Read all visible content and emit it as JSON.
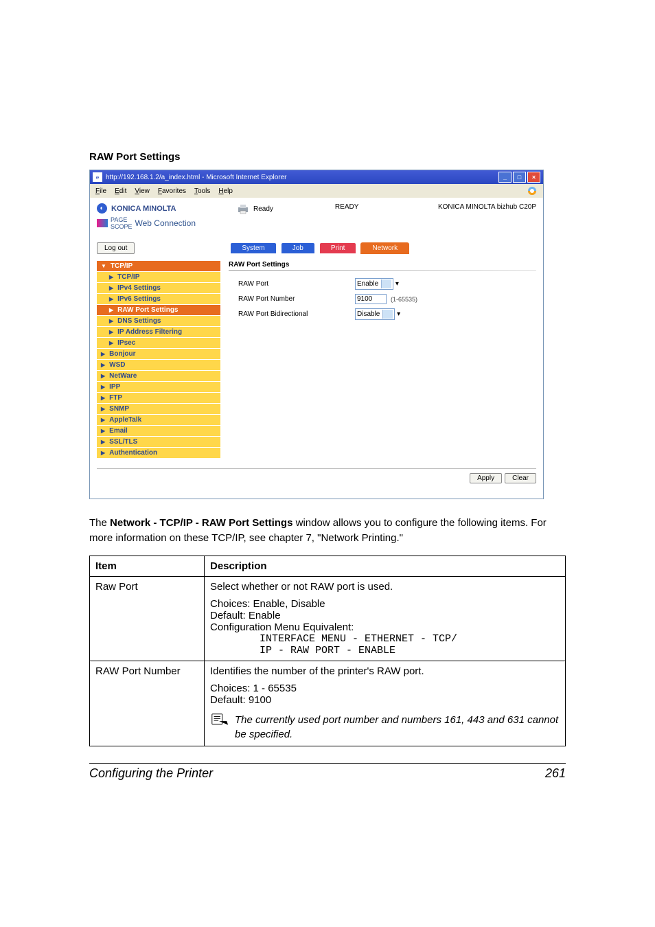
{
  "section_title": "RAW Port Settings",
  "browser": {
    "title": "http://192.168.1.2/a_index.html - Microsoft Internet Explorer",
    "menu": [
      "File",
      "Edit",
      "View",
      "Favorites",
      "Tools",
      "Help"
    ]
  },
  "header": {
    "brand": "KONICA MINOLTA",
    "pagescope": "Web Connection",
    "status_label": "Ready",
    "status_center": "READY",
    "model": "KONICA MINOLTA bizhub C20P"
  },
  "logout": "Log out",
  "tabs": [
    "System",
    "Job",
    "Print",
    "Network"
  ],
  "sidebar": {
    "head": "TCP/IP",
    "items": [
      {
        "label": "TCP/IP",
        "type": "sub"
      },
      {
        "label": "IPv4 Settings",
        "type": "sub"
      },
      {
        "label": "IPv6 Settings",
        "type": "sub"
      },
      {
        "label": "RAW Port Settings",
        "type": "sub",
        "selected": true
      },
      {
        "label": "DNS Settings",
        "type": "sub"
      },
      {
        "label": "IP Address Filtering",
        "type": "sub"
      },
      {
        "label": "IPsec",
        "type": "sub"
      },
      {
        "label": "Bonjour",
        "type": "top"
      },
      {
        "label": "WSD",
        "type": "top"
      },
      {
        "label": "NetWare",
        "type": "top"
      },
      {
        "label": "IPP",
        "type": "top"
      },
      {
        "label": "FTP",
        "type": "top"
      },
      {
        "label": "SNMP",
        "type": "top"
      },
      {
        "label": "AppleTalk",
        "type": "top"
      },
      {
        "label": "Email",
        "type": "top"
      },
      {
        "label": "SSL/TLS",
        "type": "top"
      },
      {
        "label": "Authentication",
        "type": "top"
      }
    ]
  },
  "panel": {
    "heading": "RAW Port Settings",
    "rows": {
      "raw_port_label": "RAW Port",
      "raw_port_value": "Enable",
      "raw_port_number_label": "RAW Port Number",
      "raw_port_number_value": "9100",
      "raw_port_number_hint": "(1-65535)",
      "raw_port_bidir_label": "RAW Port Bidirectional",
      "raw_port_bidir_value": "Disable"
    },
    "buttons": {
      "apply": "Apply",
      "clear": "Clear"
    }
  },
  "paragraph": {
    "pre": "The ",
    "bold": "Network - TCP/IP - RAW Port Settings",
    "post": " window allows you to configure the following items. For more information on these TCP/IP, see chapter 7, \"Network Printing.\""
  },
  "table": {
    "head_item": "Item",
    "head_desc": "Description",
    "rows": [
      {
        "item": "Raw Port",
        "desc_lines": [
          "Select whether or not RAW port is used.",
          "",
          "Choices: Enable, Disable",
          "Default:  Enable",
          "Configuration Menu Equivalent:"
        ],
        "desc_mono": "        INTERFACE MENU - ETHERNET - TCP/\n        IP - RAW PORT - ENABLE"
      },
      {
        "item": "RAW Port Number",
        "desc_lines": [
          "Identifies the number of the printer's RAW port.",
          "",
          "Choices: 1 - 65535",
          "Default:  9100"
        ],
        "note": "The currently used port number and numbers 161, 443 and 631 cannot be specified."
      }
    ]
  },
  "footer": {
    "left": "Configuring the Printer",
    "right": "261"
  }
}
